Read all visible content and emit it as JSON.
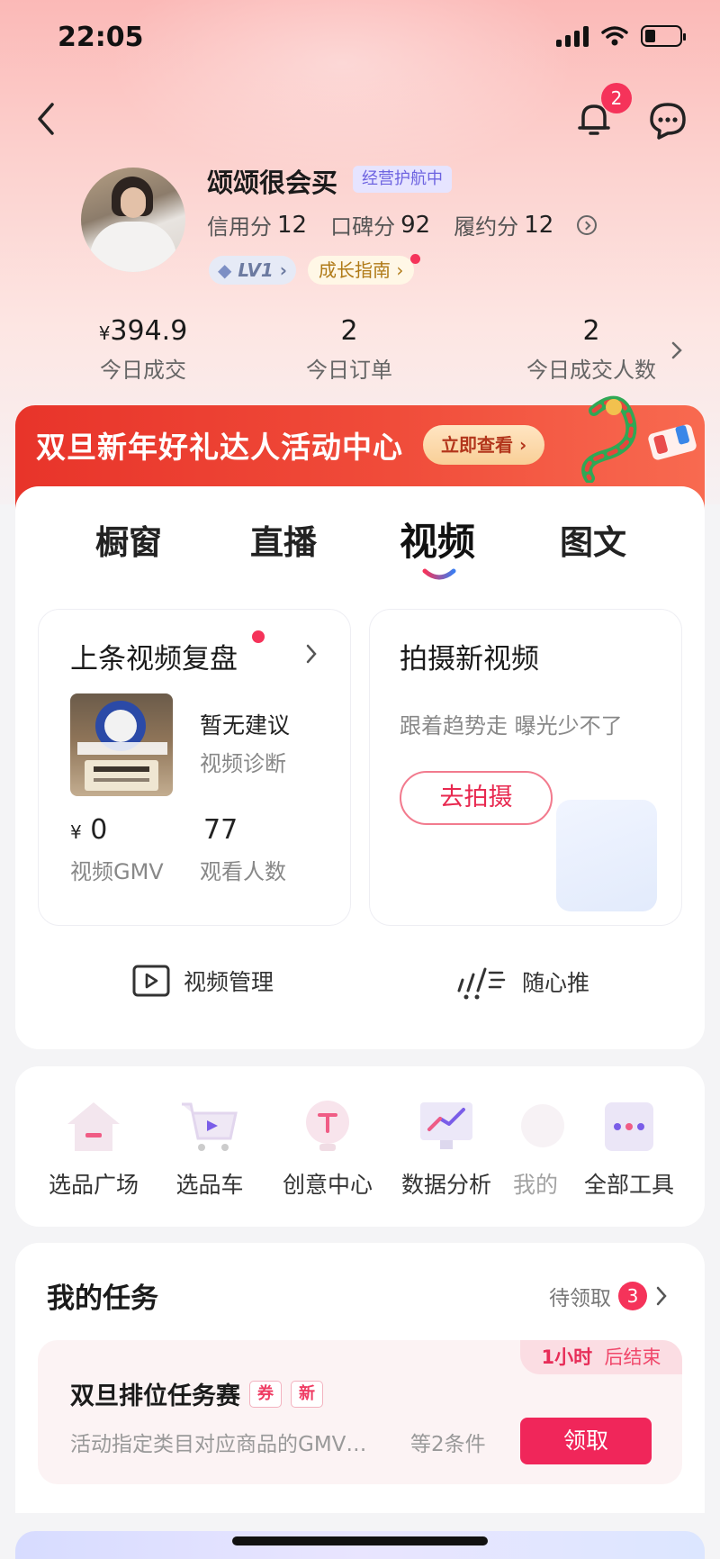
{
  "status": {
    "time": "22:05"
  },
  "header": {
    "notification_count": "2"
  },
  "profile": {
    "name": "颂颂很会买",
    "guard_tag": "经营护航中",
    "credit_label": "信用分",
    "credit_value": "12",
    "reputation_label": "口碑分",
    "reputation_value": "92",
    "fulfill_label": "履约分",
    "fulfill_value": "12",
    "level": "LV1",
    "growth_guide": "成长指南"
  },
  "today": {
    "sales_currency": "¥",
    "sales_value": "394.9",
    "sales_label": "今日成交",
    "orders_value": "2",
    "orders_label": "今日订单",
    "buyers_value": "2",
    "buyers_label": "今日成交人数"
  },
  "banner": {
    "title": "双旦新年好礼达人活动中心",
    "button": "立即查看"
  },
  "tabs": [
    {
      "label": "橱窗"
    },
    {
      "label": "直播"
    },
    {
      "label": "视频",
      "active": true
    },
    {
      "label": "图文"
    }
  ],
  "review_card": {
    "title": "上条视频复盘",
    "suggestion": "暂无建议",
    "diagnosis": "视频诊断",
    "gmv_currency": "¥",
    "gmv_value": "0",
    "gmv_label": "视频GMV",
    "viewers_value": "77",
    "viewers_label": "观看人数"
  },
  "shoot_card": {
    "title": "拍摄新视频",
    "desc": "跟着趋势走 曝光少不了",
    "button": "去拍摄"
  },
  "links": {
    "video_manage": "视频管理",
    "boost": "随心推"
  },
  "tools": [
    {
      "label": "选品广场",
      "icon": "house-icon"
    },
    {
      "label": "选品车",
      "icon": "cart-icon"
    },
    {
      "label": "创意中心",
      "icon": "bulb-icon"
    },
    {
      "label": "数据分析",
      "icon": "chart-icon"
    },
    {
      "label": "我的",
      "icon": "user-icon"
    },
    {
      "label": "全部工具",
      "icon": "more-icon"
    }
  ],
  "tasks": {
    "title": "我的任务",
    "pending_label": "待领取",
    "pending_count": "3",
    "item": {
      "time_left": "1小时",
      "time_suffix": "后结束",
      "name": "双旦排位任务赛",
      "tag1": "券",
      "tag2": "新",
      "desc": "活动指定类目对应商品的GMV…",
      "conditions": "等2条件",
      "button": "领取"
    }
  },
  "colors": {
    "accent": "#f0265a",
    "banner_red": "#e8342a",
    "guard_purple": "#6d63e0"
  }
}
